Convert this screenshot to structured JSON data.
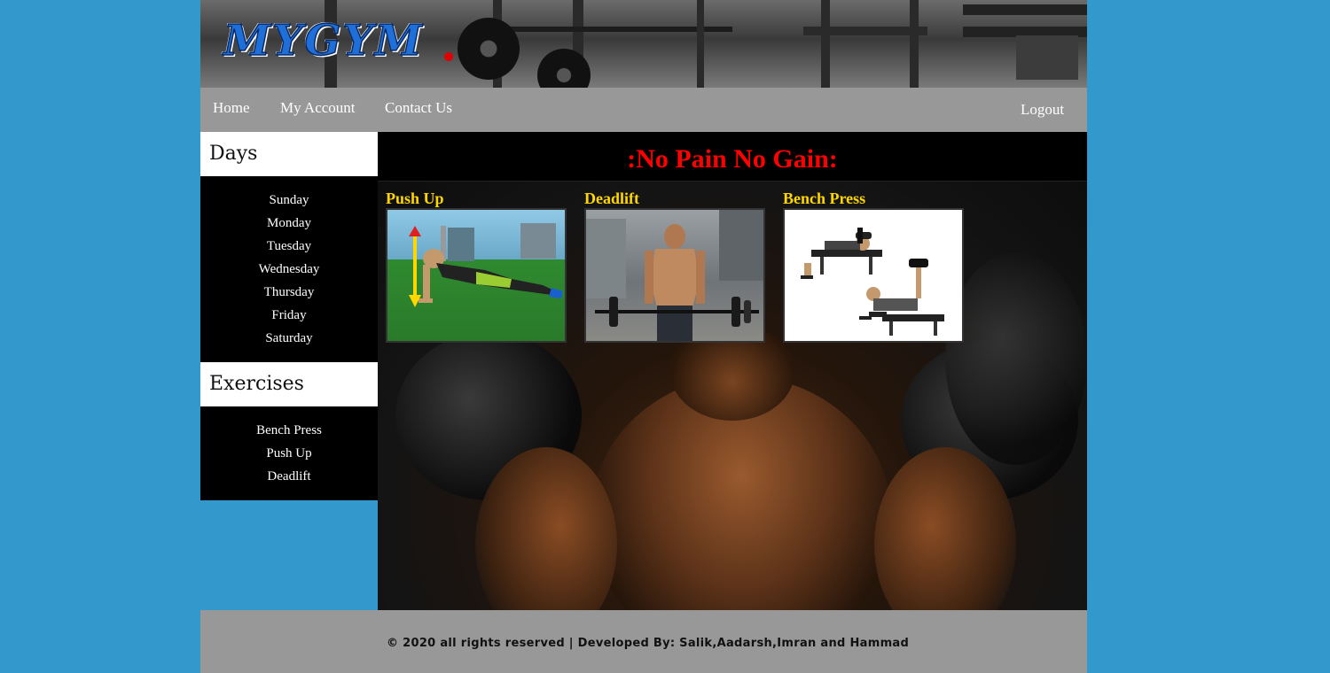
{
  "brand": {
    "logo_text": "MYGYM",
    "logo_color": "#1f6fd8",
    "dot_color": "#e00000"
  },
  "nav": {
    "items": [
      {
        "label": "Home"
      },
      {
        "label": "My Account"
      },
      {
        "label": "Contact Us"
      }
    ],
    "logout_label": "Logout",
    "background": "#989898"
  },
  "sidebar": {
    "days_heading": "Days",
    "days": [
      "Sunday",
      "Monday",
      "Tuesday",
      "Wednesday",
      "Thursday",
      "Friday",
      "Saturday"
    ],
    "exercises_heading": "Exercises",
    "exercises": [
      "Bench Press",
      "Push Up",
      "Deadlift"
    ]
  },
  "main": {
    "motto": ":No Pain No Gain:",
    "motto_color": "#ff0000",
    "cards": [
      {
        "title": "Push Up",
        "image": "push-up-photo"
      },
      {
        "title": "Deadlift",
        "image": "deadlift-photo"
      },
      {
        "title": "Bench Press",
        "image": "bench-press-illustration"
      }
    ],
    "card_title_color": "#ffd700"
  },
  "footer": {
    "text": "© 2020 all rights reserved | Developed By: Salik,Aadarsh,Imran and Hammad"
  },
  "colors": {
    "page_background": "#3399cc",
    "panel": "#000000"
  }
}
